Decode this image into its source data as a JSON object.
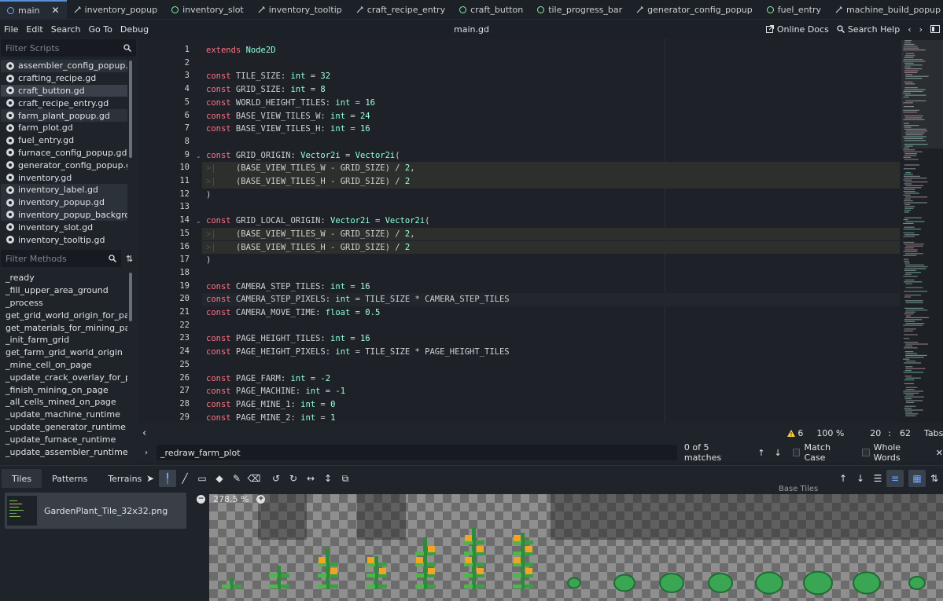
{
  "tabs": [
    {
      "label": "main",
      "active": true,
      "icon": "script-circle-icon",
      "closable": true
    },
    {
      "label": "inventory_popup",
      "icon": "scene-doc-icon"
    },
    {
      "label": "inventory_slot",
      "icon": "script-circle-icon"
    },
    {
      "label": "inventory_tooltip",
      "icon": "scene-doc-icon"
    },
    {
      "label": "craft_recipe_entry",
      "icon": "scene-doc-icon"
    },
    {
      "label": "craft_button",
      "icon": "script-circle-icon"
    },
    {
      "label": "tile_progress_bar",
      "icon": "script-circle-icon"
    },
    {
      "label": "generator_config_popup",
      "icon": "scene-doc-icon"
    },
    {
      "label": "fuel_entry",
      "icon": "script-circle-icon"
    },
    {
      "label": "machine_build_popup",
      "icon": "scene-doc-icon"
    }
  ],
  "menu": {
    "items": [
      "File",
      "Edit",
      "Search",
      "Go To",
      "Debug"
    ],
    "file_title": "main.gd",
    "online_docs": "Online Docs",
    "search_help": "Search Help"
  },
  "scripts": {
    "filter_placeholder": "Filter Scripts",
    "items": [
      "assembler_config_popup.gd",
      "crafting_recipe.gd",
      "craft_button.gd",
      "craft_recipe_entry.gd",
      "farm_plant_popup.gd",
      "farm_plot.gd",
      "fuel_entry.gd",
      "furnace_config_popup.gd",
      "generator_config_popup.gd",
      "inventory.gd",
      "inventory_label.gd",
      "inventory_popup.gd",
      "inventory_popup_backgroun...",
      "inventory_slot.gd",
      "inventory_tooltip.gd"
    ]
  },
  "methods": {
    "filter_placeholder": "Filter Methods",
    "items": [
      "_ready",
      "_fill_upper_area_ground",
      "_process",
      "get_grid_world_origin_for_page",
      "get_materials_for_mining_page",
      "_init_farm_grid",
      "get_farm_grid_world_origin",
      "_mine_cell_on_page",
      "_update_crack_overlay_for_page",
      "_finish_mining_on_page",
      "_all_cells_mined_on_page",
      "_update_machine_runtime",
      "_update_generator_runtime",
      "_update_furnace_runtime",
      "_update_assembler_runtime"
    ]
  },
  "code": [
    {
      "n": "1",
      "t": "extends Node2D"
    },
    {
      "n": "2",
      "t": ""
    },
    {
      "n": "3",
      "t": "const TILE_SIZE: int = 32"
    },
    {
      "n": "4",
      "t": "const GRID_SIZE: int = 8"
    },
    {
      "n": "5",
      "t": "const WORLD_HEIGHT_TILES: int = 16"
    },
    {
      "n": "6",
      "t": "const BASE_VIEW_TILES_W: int = 24"
    },
    {
      "n": "7",
      "t": "const BASE_VIEW_TILES_H: int = 16"
    },
    {
      "n": "8",
      "t": ""
    },
    {
      "n": "9",
      "t": "const GRID_ORIGIN: Vector2i = Vector2i("
    },
    {
      "n": "10",
      "t": "\t(BASE_VIEW_TILES_W - GRID_SIZE) / 2,"
    },
    {
      "n": "11",
      "t": "\t(BASE_VIEW_TILES_H - GRID_SIZE) / 2"
    },
    {
      "n": "12",
      "t": ")"
    },
    {
      "n": "13",
      "t": ""
    },
    {
      "n": "14",
      "t": "const GRID_LOCAL_ORIGIN: Vector2i = Vector2i("
    },
    {
      "n": "15",
      "t": "\t(BASE_VIEW_TILES_W - GRID_SIZE) / 2,"
    },
    {
      "n": "16",
      "t": "\t(BASE_VIEW_TILES_H - GRID_SIZE) / 2"
    },
    {
      "n": "17",
      "t": ")"
    },
    {
      "n": "18",
      "t": ""
    },
    {
      "n": "19",
      "t": "const CAMERA_STEP_TILES: int = 16"
    },
    {
      "n": "20",
      "t": "const CAMERA_STEP_PIXELS: int = TILE_SIZE * CAMERA_STEP_TILES"
    },
    {
      "n": "21",
      "t": "const CAMERA_MOVE_TIME: float = 0.5"
    },
    {
      "n": "22",
      "t": ""
    },
    {
      "n": "23",
      "t": "const PAGE_HEIGHT_TILES: int = 16"
    },
    {
      "n": "24",
      "t": "const PAGE_HEIGHT_PIXELS: int = TILE_SIZE * PAGE_HEIGHT_TILES"
    },
    {
      "n": "25",
      "t": ""
    },
    {
      "n": "26",
      "t": "const PAGE_FARM: int = -2"
    },
    {
      "n": "27",
      "t": "const PAGE_MACHINE: int = -1"
    },
    {
      "n": "28",
      "t": "const PAGE_MINE_1: int = 0"
    },
    {
      "n": "29",
      "t": "const PAGE_MINE_2: int = 1"
    }
  ],
  "status": {
    "warnings": "6",
    "zoom": "100 %",
    "line": "20",
    "col": "62",
    "indent": "Tabs"
  },
  "search": {
    "query": "_redraw_farm_plot",
    "matches": "0 of 5 matches",
    "match_case": "Match Case",
    "whole_words": "Whole Words"
  },
  "bottom": {
    "tabs": [
      "Tiles",
      "Patterns",
      "Terrains"
    ],
    "source_name": "GardenPlant_Tile_32x32.png",
    "zoom": "278.5 %",
    "atlas_title": "Base Tiles"
  },
  "colors": {
    "keyword": "#ff7085",
    "type": "#8effda",
    "accent": "#5a8fd6",
    "warning": "#ffcc44"
  }
}
